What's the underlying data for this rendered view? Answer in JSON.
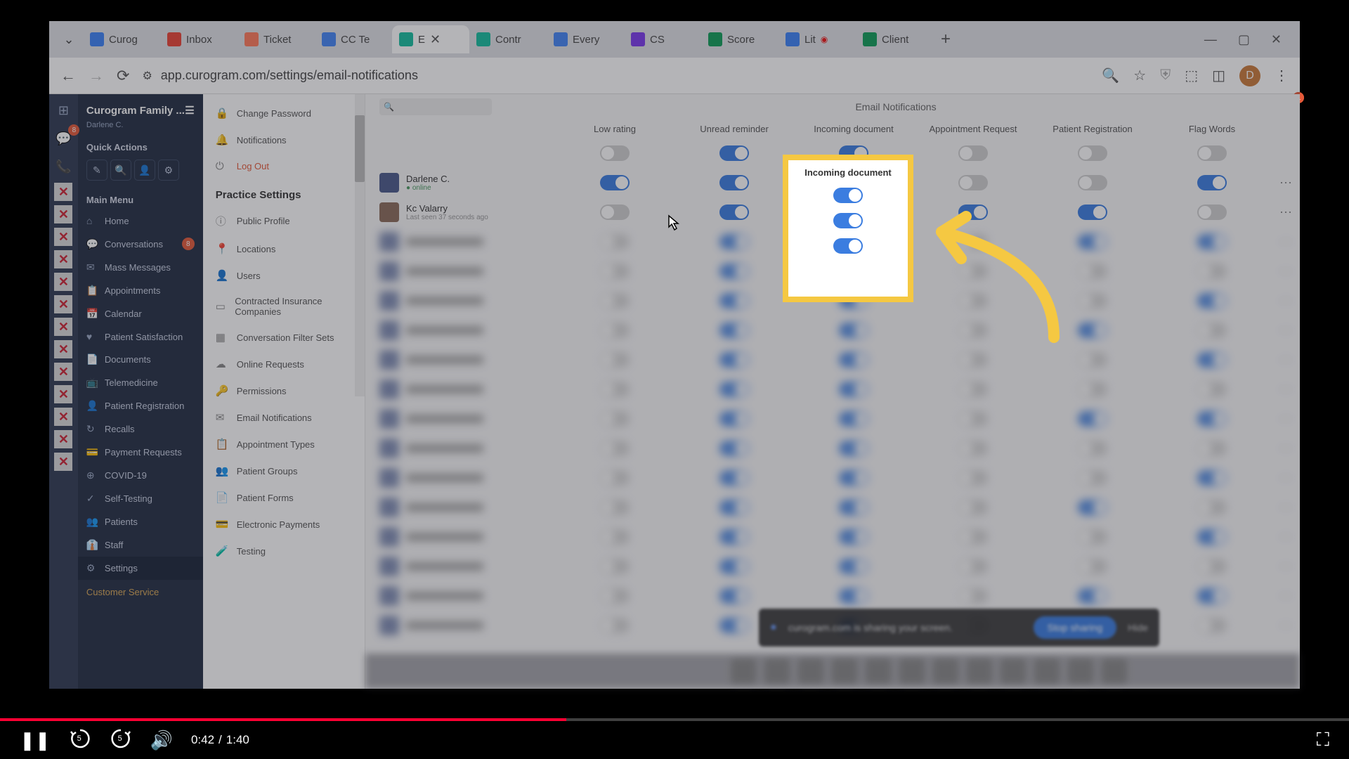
{
  "browser": {
    "tabs": [
      {
        "label": "Curog",
        "icon_bg": "#3b82f6"
      },
      {
        "label": "Inbox",
        "icon_bg": "#ea4335"
      },
      {
        "label": "Ticket",
        "icon_bg": "#ff7a59"
      },
      {
        "label": "CC Te",
        "icon_bg": "#4285f4"
      },
      {
        "label": "E",
        "icon_bg": "#15be9f",
        "active": true
      },
      {
        "label": "Contr",
        "icon_bg": "#15be9f"
      },
      {
        "label": "Every",
        "icon_bg": "#4285f4"
      },
      {
        "label": "CS",
        "icon_bg": "#7c3aed"
      },
      {
        "label": "Score",
        "icon_bg": "#0f9d58"
      },
      {
        "label": "Lit",
        "icon_bg": "#3b82f6",
        "rec": true
      },
      {
        "label": "Client",
        "icon_bg": "#0f9d58"
      }
    ],
    "url": "app.curogram.com/settings/email-notifications",
    "profile_initial": "D"
  },
  "sidebar1": {
    "org": "Curogram Family ...",
    "user": "Darlene C.",
    "quick_actions_title": "Quick Actions",
    "main_menu_title": "Main Menu",
    "items": [
      {
        "icon": "⌂",
        "label": "Home"
      },
      {
        "icon": "💬",
        "label": "Conversations",
        "badge": "8"
      },
      {
        "icon": "✉",
        "label": "Mass Messages"
      },
      {
        "icon": "📋",
        "label": "Appointments"
      },
      {
        "icon": "📅",
        "label": "Calendar"
      },
      {
        "icon": "♥",
        "label": "Patient Satisfaction"
      },
      {
        "icon": "📄",
        "label": "Documents"
      },
      {
        "icon": "📺",
        "label": "Telemedicine"
      },
      {
        "icon": "👤",
        "label": "Patient Registration"
      },
      {
        "icon": "↻",
        "label": "Recalls"
      },
      {
        "icon": "💳",
        "label": "Payment Requests"
      },
      {
        "icon": "⊕",
        "label": "COVID-19"
      },
      {
        "icon": "✓",
        "label": "Self-Testing"
      },
      {
        "icon": "👥",
        "label": "Patients"
      },
      {
        "icon": "👔",
        "label": "Staff"
      },
      {
        "icon": "⚙",
        "label": "Settings",
        "active": true
      }
    ],
    "footer": "Customer Service"
  },
  "sidebar2": {
    "top_items": [
      {
        "icon": "🔒",
        "label": "Change Password"
      },
      {
        "icon": "🔔",
        "label": "Notifications"
      },
      {
        "icon": "⏻",
        "label": "Log Out",
        "logout": true
      }
    ],
    "section_title": "Practice Settings",
    "settings_items": [
      {
        "icon": "ⓘ",
        "label": "Public Profile"
      },
      {
        "icon": "📍",
        "label": "Locations"
      },
      {
        "icon": "👤",
        "label": "Users"
      },
      {
        "icon": "▭",
        "label": "Contracted Insurance Companies"
      },
      {
        "icon": "▦",
        "label": "Conversation Filter Sets"
      },
      {
        "icon": "☁",
        "label": "Online Requests"
      },
      {
        "icon": "🔑",
        "label": "Permissions"
      },
      {
        "icon": "✉",
        "label": "Email Notifications"
      },
      {
        "icon": "📋",
        "label": "Appointment Types"
      },
      {
        "icon": "👥",
        "label": "Patient Groups"
      },
      {
        "icon": "📄",
        "label": "Patient Forms"
      },
      {
        "icon": "💳",
        "label": "Electronic Payments"
      },
      {
        "icon": "🧪",
        "label": "Testing"
      }
    ]
  },
  "main": {
    "title": "Email Notifications",
    "search_placeholder": "",
    "columns": [
      "Low rating",
      "Unread reminder",
      "Incoming document",
      "Appointment Request",
      "Patient Registration",
      "Flag Words"
    ],
    "header_toggles": [
      false,
      true,
      true,
      false,
      false,
      false
    ],
    "rows": [
      {
        "name": "Darlene C.",
        "status": "online",
        "avatar": "#4a5a8a",
        "toggles": [
          true,
          true,
          true,
          false,
          false,
          true
        ]
      },
      {
        "name": "Kc Valarry",
        "status": "Last seen 37 seconds ago",
        "avatar": "#8a6a5a",
        "toggles": [
          false,
          true,
          true,
          true,
          true,
          false
        ]
      }
    ],
    "blurred_row_count": 14
  },
  "highlight": {
    "title": "Incoming document"
  },
  "share_banner": {
    "text": "curogram.com is sharing your screen.",
    "stop": "Stop sharing",
    "hide": "Hide"
  },
  "player": {
    "current": "0:42",
    "total": "1:40",
    "progress_pct": 42
  }
}
